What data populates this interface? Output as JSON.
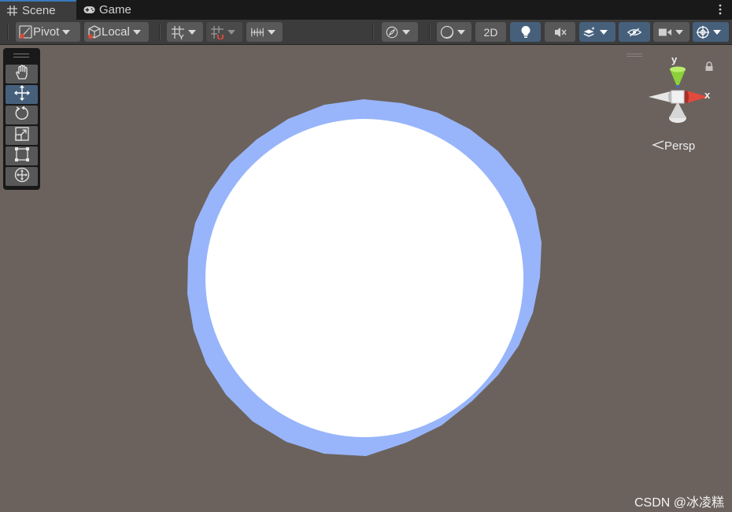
{
  "tabs": [
    {
      "label": "Scene",
      "icon": "grid-icon",
      "active": true
    },
    {
      "label": "Game",
      "icon": "gamepad-icon",
      "active": false
    }
  ],
  "toolbar": {
    "pivot_label": "Pivot",
    "local_label": "Local",
    "mode_2d_label": "2D"
  },
  "tools": [
    {
      "name": "hand-tool",
      "icon": "hand-icon",
      "active": false
    },
    {
      "name": "move-tool",
      "icon": "move-arrows-icon",
      "active": true
    },
    {
      "name": "rotate-tool",
      "icon": "rotate-icon",
      "active": false
    },
    {
      "name": "scale-tool",
      "icon": "scale-icon",
      "active": false
    },
    {
      "name": "rect-tool",
      "icon": "rect-transform-icon",
      "active": false
    },
    {
      "name": "transform-tool",
      "icon": "transform-icon",
      "active": false
    }
  ],
  "gizmo": {
    "y_label": "y",
    "x_label": "x",
    "projection_label": "Persp"
  },
  "colors": {
    "scene_background": "#6b625d",
    "ring_color": "#98b5fb",
    "disc_color": "#ffffff",
    "accent": "#46607c"
  },
  "watermark": "CSDN @冰凌糕"
}
